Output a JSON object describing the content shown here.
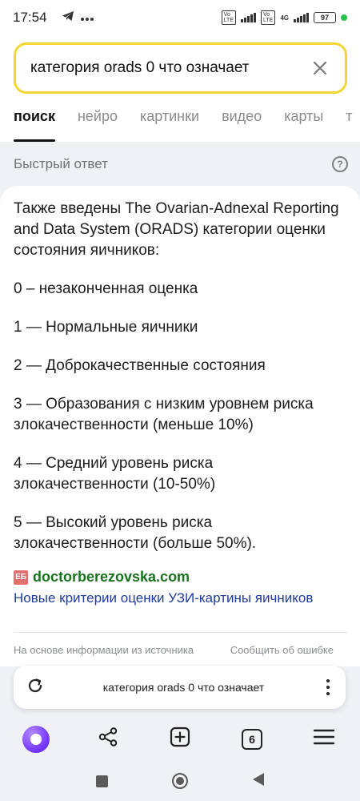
{
  "status_bar": {
    "time": "17:54",
    "battery": "97",
    "net_label": "4G"
  },
  "search": {
    "query": "категория orads 0 что означает"
  },
  "tabs": [
    {
      "label": "поиск"
    },
    {
      "label": "нейро"
    },
    {
      "label": "картинки"
    },
    {
      "label": "видео"
    },
    {
      "label": "карты"
    },
    {
      "label": "т"
    }
  ],
  "quick_answer": {
    "title": "Быстрый ответ",
    "help_glyph": "?",
    "intro": "Также введены The Ovarian-Adnexal Reporting and Data System (ORADS) категории оценки состояния яичников:",
    "items": [
      "0 – незаконченная оценка",
      "1 — Нормальные яичники",
      "2 — Доброкачественные состояния",
      "3 — Образования с низким уровнем риска злокачественности (меньше 10%)",
      "4 — Средний уровень риска злокачественности (10-50%)",
      "5 — Высокий уровень риска злокачественности (больше 50%)."
    ],
    "source_favicon": "ЕБ",
    "source_domain": "doctorberezovska.com",
    "source_title": "Новые критерии оценки УЗИ-картины яичников",
    "footer_left": "На основе информации из источника",
    "footer_right": "Сообщить об ошибке"
  },
  "bottom_bar": {
    "query": "категория orads 0 что означает"
  },
  "toolbar": {
    "tabs_count": "6"
  },
  "colors": {
    "search_border": "#f4d631",
    "source_domain": "#18721e",
    "link": "#1e3a9f",
    "alice": "#7a3cff"
  }
}
